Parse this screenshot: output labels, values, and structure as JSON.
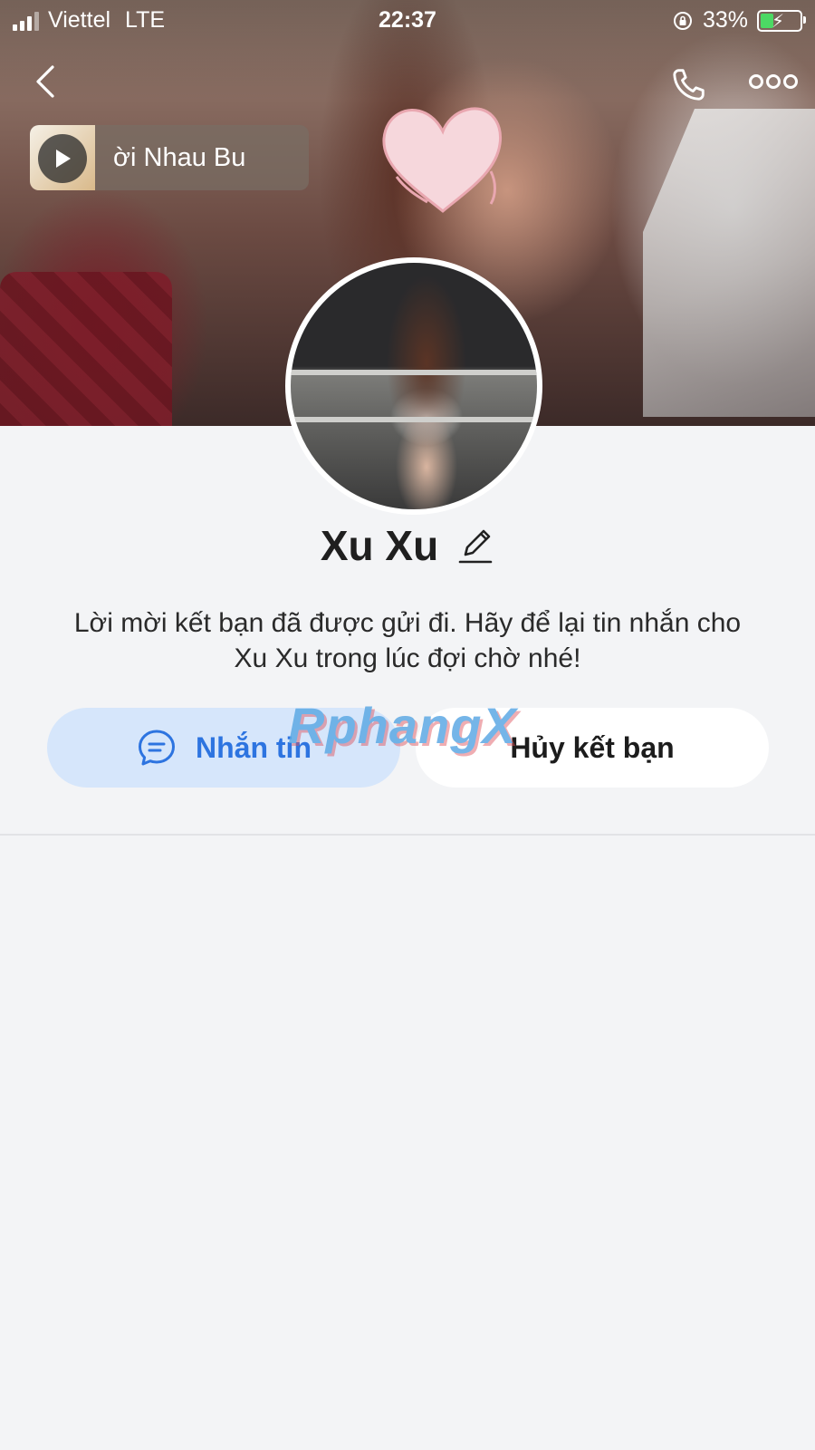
{
  "status_bar": {
    "carrier": "Viettel",
    "network": "LTE",
    "time": "22:37",
    "battery": "33%"
  },
  "header": {
    "back_icon": "chevron-left-icon",
    "call_icon": "phone-icon",
    "more_icon": "more-horizontal-icon"
  },
  "music": {
    "title": "ời Nhau        Bu",
    "play_icon": "play-icon"
  },
  "profile": {
    "name": "Xu Xu",
    "edit_icon": "pencil-icon",
    "message": "Lời mời kết bạn đã được gửi đi. Hãy để lại tin nhắn cho Xu Xu trong lúc đợi chờ nhé!"
  },
  "actions": {
    "message_label": "Nhắn tin",
    "message_icon": "chat-bubble-icon",
    "cancel_label": "Hủy kết bạn"
  },
  "watermark": "RphangX",
  "colors": {
    "accent": "#2d74e0",
    "accent_bg": "#d6e6fb",
    "page_bg": "#f3f4f6"
  }
}
